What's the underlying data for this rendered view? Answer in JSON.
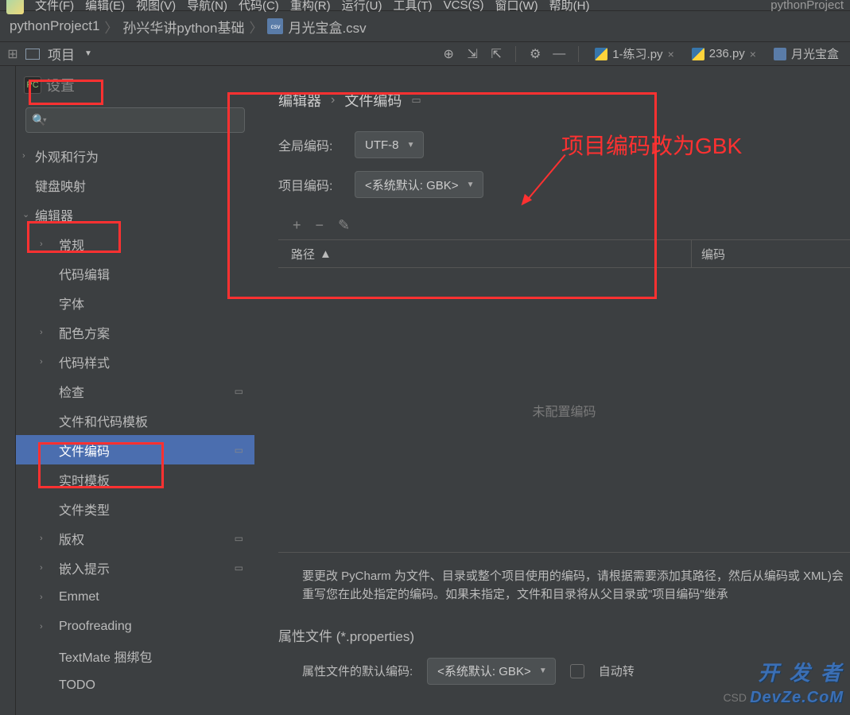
{
  "menu": {
    "items": [
      "文件(F)",
      "编辑(E)",
      "视图(V)",
      "导航(N)",
      "代码(C)",
      "重构(R)",
      "运行(U)",
      "工具(T)",
      "VCS(S)",
      "窗口(W)",
      "帮助(H)"
    ],
    "project_name": "pythonProject"
  },
  "breadcrumb": {
    "a": "pythonProject1",
    "b": "孙兴华讲python基础",
    "c": "月光宝盒.csv"
  },
  "toolbar": {
    "project_label": "项目",
    "tabs": [
      {
        "label": "1-练习.py",
        "type": "py"
      },
      {
        "label": "236.py",
        "type": "py"
      },
      {
        "label": "月光宝盒",
        "type": "csv"
      }
    ]
  },
  "settings": {
    "title": "设置",
    "tree": [
      {
        "label": "外观和行为",
        "level": 1,
        "chevron": "›"
      },
      {
        "label": "键盘映射",
        "level": 1,
        "chevron": ""
      },
      {
        "label": "编辑器",
        "level": 1,
        "chevron": "⌄"
      },
      {
        "label": "常规",
        "level": 2,
        "chevron": "›"
      },
      {
        "label": "代码编辑",
        "level": 2,
        "chevron": ""
      },
      {
        "label": "字体",
        "level": 2,
        "chevron": ""
      },
      {
        "label": "配色方案",
        "level": 2,
        "chevron": "›"
      },
      {
        "label": "代码样式",
        "level": 2,
        "chevron": "›"
      },
      {
        "label": "检查",
        "level": 2,
        "chevron": "",
        "badge": "▭"
      },
      {
        "label": "文件和代码模板",
        "level": 2,
        "chevron": ""
      },
      {
        "label": "文件编码",
        "level": 2,
        "chevron": "",
        "selected": true,
        "badge": "▭"
      },
      {
        "label": "实时模板",
        "level": 2,
        "chevron": ""
      },
      {
        "label": "文件类型",
        "level": 2,
        "chevron": ""
      },
      {
        "label": "版权",
        "level": 2,
        "chevron": "›",
        "badge": "▭"
      },
      {
        "label": "嵌入提示",
        "level": 2,
        "chevron": "›",
        "badge": "▭"
      },
      {
        "label": "Emmet",
        "level": 2,
        "chevron": "›"
      },
      {
        "label": "Proofreading",
        "level": 2,
        "chevron": "›"
      },
      {
        "label": "TextMate 捆绑包",
        "level": 2,
        "chevron": ""
      },
      {
        "label": "TODO",
        "level": 2,
        "chevron": ""
      }
    ]
  },
  "content": {
    "breadcrumb_a": "编辑器",
    "breadcrumb_b": "文件编码",
    "global_label": "全局编码:",
    "global_value": "UTF-8",
    "project_label": "项目编码:",
    "project_value": "<系统默认: GBK>",
    "table": {
      "col1": "路径",
      "col2": "编码",
      "empty": "未配置编码"
    },
    "help": "要更改 PyCharm 为文件、目录或整个项目使用的编码，请根据需要添加其路径，然后从编码或 XML)会重写您在此处指定的编码。如果未指定，文件和目录将从父目录或\"项目编码\"继承",
    "props_title": "属性文件 (*.properties)",
    "props_label": "属性文件的默认编码:",
    "props_value": "<系统默认: GBK>",
    "props_checkbox": "自动转"
  },
  "annotation": "项目编码改为GBK",
  "watermark": {
    "line1": "开 发 者",
    "line2": "DevZe.CoM",
    "csdn": "CSD"
  }
}
